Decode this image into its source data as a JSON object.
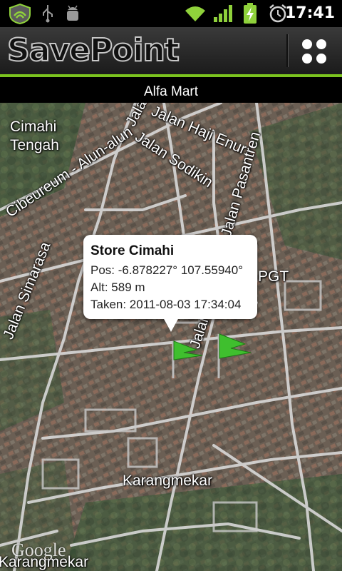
{
  "status_bar": {
    "time": "17:41",
    "icons": [
      "shield-icon",
      "usb-icon",
      "android-debug-icon",
      "wifi-icon",
      "signal-icon",
      "battery-charging-icon",
      "alarm-icon"
    ]
  },
  "app": {
    "title": "SavePoint",
    "menu_icon": "grid-menu-icon",
    "accent": "#7cc41f"
  },
  "location_title": "Alfa Mart",
  "map": {
    "labels": {
      "cimahi_tengah_1": "Cimahi",
      "cimahi_tengah_2": "Tengah",
      "jalan_haji_enur": "Jalan Haji Enur",
      "jalan_sodikin": "Jalan Sodikin",
      "jalan_pasantren": "Jalan Pasantren",
      "cibeureum": "Cibeureum - Alun-alun",
      "jalan_simarasa": "Jalan Simarasa",
      "karangmekar": "Karangmekar",
      "pgt": "PGT",
      "karangmekar_bottom": "Karangmekar",
      "jalan_partial_top": "Jala",
      "jalan_partial_mid": "Jalan P"
    },
    "markers": [
      {
        "name": "Store Cimahi",
        "flag": "green-flag-icon"
      },
      {
        "name": "Alfa Mart",
        "flag": "green-flag-icon"
      }
    ],
    "attribution": "Google"
  },
  "callout": {
    "title": "Store Cimahi",
    "pos": "Pos: -6.878227° 107.55940°",
    "alt": "Alt: 589 m",
    "taken": "Taken: 2011-08-03 17:34:04"
  }
}
